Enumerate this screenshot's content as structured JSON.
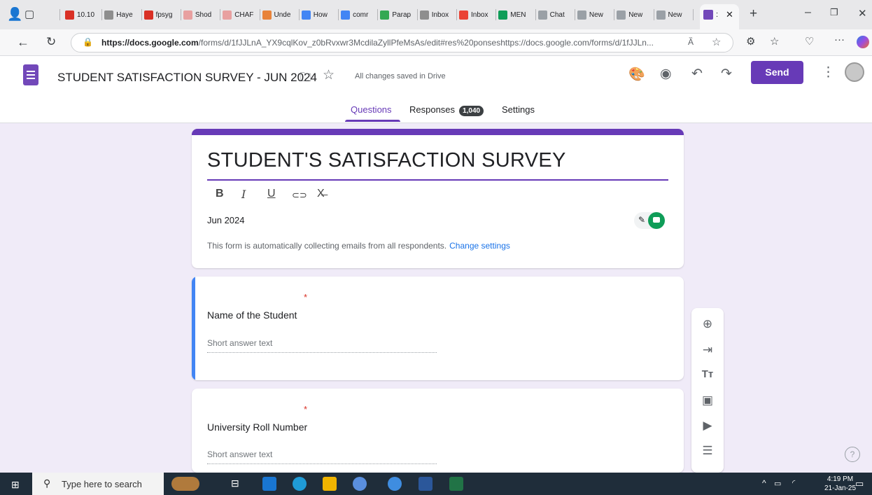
{
  "browser": {
    "tabs": [
      {
        "label": "10.10",
        "color": "#d93025"
      },
      {
        "label": "Haye",
        "color": "#8e8e8e"
      },
      {
        "label": "fpsyg",
        "color": "#d93025"
      },
      {
        "label": "Shod",
        "color": "#e8a0a0"
      },
      {
        "label": "CHAF",
        "color": "#e8a0a0"
      },
      {
        "label": "Unde",
        "color": "#e8833a"
      },
      {
        "label": "How",
        "color": "#4285f4"
      },
      {
        "label": "comr",
        "color": "#4285f4"
      },
      {
        "label": "Parap",
        "color": "#34a853"
      },
      {
        "label": "Inbox",
        "color": "#8e8e8e"
      },
      {
        "label": "Inbox",
        "color": "#ea4335"
      },
      {
        "label": "MEN",
        "color": "#0f9d58"
      },
      {
        "label": "Chat",
        "color": "#9aa0a6"
      },
      {
        "label": "New",
        "color": "#9aa0a6"
      },
      {
        "label": "New",
        "color": "#9aa0a6"
      },
      {
        "label": "New",
        "color": "#9aa0a6"
      }
    ],
    "active_tab_label": ":",
    "url_host": "https://docs.google.com",
    "url_path": "/forms/d/1fJJLnA_YX9cqlKov_z0bRvxwr3McdilaZyllPfeMsAs/edit#res%20ponseshttps://docs.google.com/forms/d/1fJJLn..."
  },
  "header": {
    "form_title": "STUDENT SATISFACTION SURVEY - JUN 2024",
    "save_status": "All changes saved in Drive",
    "send_label": "Send",
    "tabs": {
      "questions": "Questions",
      "responses": "Responses",
      "responses_count": "1,040",
      "settings": "Settings"
    }
  },
  "form": {
    "title": "STUDENT'S SATISFACTION SURVEY",
    "format_buttons": [
      "B",
      "I",
      "U",
      "⊂⊃",
      "X̶"
    ],
    "description": "Jun 2024",
    "email_notice": "This form is automatically collecting emails from all respondents.",
    "change_settings_label": "Change settings",
    "questions": [
      {
        "label": "Name of the Student",
        "placeholder": "Short answer text",
        "required": "*"
      },
      {
        "label": "University Roll Number",
        "placeholder": "Short answer text",
        "required": "*"
      }
    ]
  },
  "taskbar": {
    "search_placeholder": "Type here to search",
    "time": "4:19 PM",
    "date": "21-Jan-25"
  },
  "colors": {
    "accent": "#673ab7",
    "focus_bar": "#4285f4",
    "background": "#f0ebf8"
  }
}
